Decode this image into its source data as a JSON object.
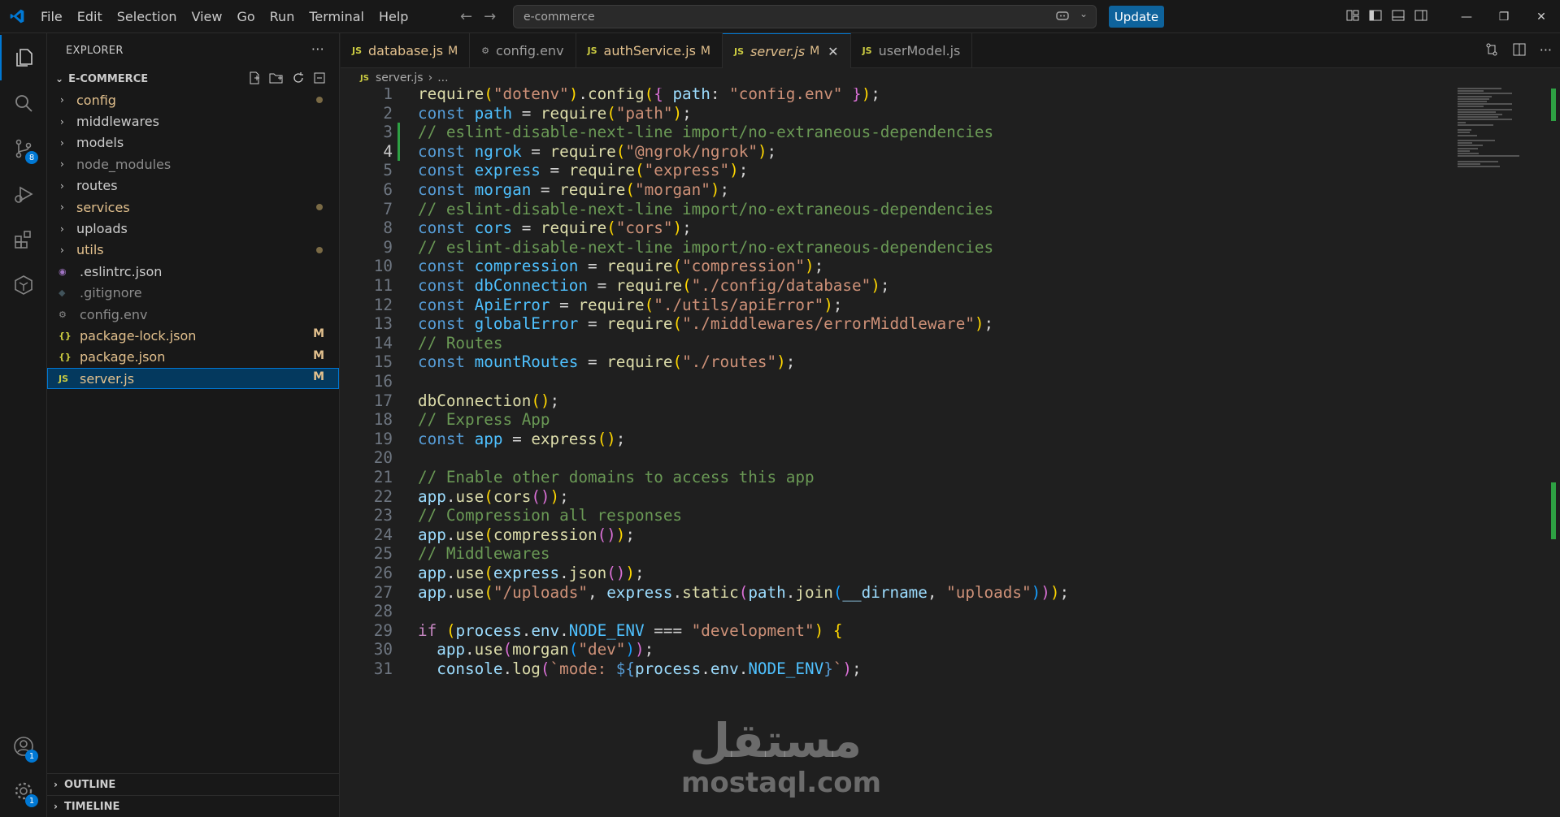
{
  "titlebar": {
    "menu": [
      "File",
      "Edit",
      "Selection",
      "View",
      "Go",
      "Run",
      "Terminal",
      "Help"
    ],
    "search_text": "e-commerce",
    "update_label": "Update"
  },
  "activity": {
    "scm_badge": "8",
    "accounts_badge": "1",
    "settings_badge": "1"
  },
  "sidebar": {
    "title": "EXPLORER",
    "more": "···",
    "project": "E-COMMERCE",
    "folders": [
      {
        "name": "config",
        "color": "#e2c08d",
        "dot": true
      },
      {
        "name": "middlewares",
        "color": "#cccccc",
        "dot": false
      },
      {
        "name": "models",
        "color": "#cccccc",
        "dot": false
      },
      {
        "name": "node_modules",
        "color": "#8c8c8c",
        "dot": false
      },
      {
        "name": "routes",
        "color": "#cccccc",
        "dot": false
      },
      {
        "name": "services",
        "color": "#e2c08d",
        "dot": true
      },
      {
        "name": "uploads",
        "color": "#cccccc",
        "dot": false
      },
      {
        "name": "utils",
        "color": "#e2c08d",
        "dot": true
      }
    ],
    "files": [
      {
        "name": ".eslintrc.json",
        "color": "#cccccc",
        "icon": "◉",
        "icon_color": "#a074c4",
        "mark": ""
      },
      {
        "name": ".gitignore",
        "color": "#8c8c8c",
        "icon": "◆",
        "icon_color": "#41535b",
        "mark": ""
      },
      {
        "name": "config.env",
        "color": "#8c8c8c",
        "icon": "⚙",
        "icon_color": "#8c8c8c",
        "mark": ""
      },
      {
        "name": "package-lock.json",
        "color": "#e2c08d",
        "icon": "{}",
        "icon_color": "#cbcb41",
        "mark": "M"
      },
      {
        "name": "package.json",
        "color": "#e2c08d",
        "icon": "{}",
        "icon_color": "#cbcb41",
        "mark": "M"
      },
      {
        "name": "server.js",
        "color": "#e2c08d",
        "icon": "JS",
        "icon_color": "#cbcb41",
        "mark": "M"
      }
    ],
    "outline": "OUTLINE",
    "timeline": "TIMELINE"
  },
  "tabs": [
    {
      "name": "database.js",
      "icon": "JS",
      "icon_color": "#cbcb41",
      "color": "#e2c08d",
      "mark": "M",
      "active": false
    },
    {
      "name": "config.env",
      "icon": "⚙",
      "icon_color": "#9d9d9d",
      "color": "#9d9d9d",
      "mark": "",
      "active": false
    },
    {
      "name": "authService.js",
      "icon": "JS",
      "icon_color": "#cbcb41",
      "color": "#e2c08d",
      "mark": "M",
      "active": false
    },
    {
      "name": "server.js",
      "icon": "JS",
      "icon_color": "#cbcb41",
      "color": "#e2c08d",
      "mark": "M",
      "active": true
    },
    {
      "name": "userModel.js",
      "icon": "JS",
      "icon_color": "#cbcb41",
      "color": "#9d9d9d",
      "mark": "",
      "active": false
    }
  ],
  "breadcrumb": {
    "icon": "JS",
    "file": "server.js",
    "sep": "›",
    "rest": "..."
  },
  "code_lines": [
    [
      [
        "fn",
        "require"
      ],
      [
        "b1",
        "("
      ],
      [
        "str",
        "\"dotenv\""
      ],
      [
        "b1",
        ")"
      ],
      [
        "pl",
        "."
      ],
      [
        "fn",
        "config"
      ],
      [
        "b1",
        "("
      ],
      [
        "b2",
        "{"
      ],
      [
        "pl",
        " "
      ],
      [
        "var",
        "path"
      ],
      [
        "pl",
        ": "
      ],
      [
        "str",
        "\"config.env\""
      ],
      [
        "pl",
        " "
      ],
      [
        "b2",
        "}"
      ],
      [
        "b1",
        ")"
      ],
      [
        "pl",
        ";"
      ]
    ],
    [
      [
        "kw",
        "const"
      ],
      [
        "pl",
        " "
      ],
      [
        "cnst",
        "path"
      ],
      [
        "pl",
        " = "
      ],
      [
        "fn",
        "require"
      ],
      [
        "b1",
        "("
      ],
      [
        "str",
        "\"path\""
      ],
      [
        "b1",
        ")"
      ],
      [
        "pl",
        ";"
      ]
    ],
    [
      [
        "cm",
        "// eslint-disable-next-line import/no-extraneous-dependencies"
      ]
    ],
    [
      [
        "kw",
        "const"
      ],
      [
        "pl",
        " "
      ],
      [
        "cnst",
        "ngrok"
      ],
      [
        "pl",
        " = "
      ],
      [
        "fn",
        "require"
      ],
      [
        "b1",
        "("
      ],
      [
        "str",
        "\"@ngrok/ngrok\""
      ],
      [
        "b1",
        ")"
      ],
      [
        "pl",
        ";"
      ]
    ],
    [
      [
        "kw",
        "const"
      ],
      [
        "pl",
        " "
      ],
      [
        "cnst",
        "express"
      ],
      [
        "pl",
        " = "
      ],
      [
        "fn",
        "require"
      ],
      [
        "b1",
        "("
      ],
      [
        "str",
        "\"express\""
      ],
      [
        "b1",
        ")"
      ],
      [
        "pl",
        ";"
      ]
    ],
    [
      [
        "kw",
        "const"
      ],
      [
        "pl",
        " "
      ],
      [
        "cnst",
        "morgan"
      ],
      [
        "pl",
        " = "
      ],
      [
        "fn",
        "require"
      ],
      [
        "b1",
        "("
      ],
      [
        "str",
        "\"morgan\""
      ],
      [
        "b1",
        ")"
      ],
      [
        "pl",
        ";"
      ]
    ],
    [
      [
        "cm",
        "// eslint-disable-next-line import/no-extraneous-dependencies"
      ]
    ],
    [
      [
        "kw",
        "const"
      ],
      [
        "pl",
        " "
      ],
      [
        "cnst",
        "cors"
      ],
      [
        "pl",
        " = "
      ],
      [
        "fn",
        "require"
      ],
      [
        "b1",
        "("
      ],
      [
        "str",
        "\"cors\""
      ],
      [
        "b1",
        ")"
      ],
      [
        "pl",
        ";"
      ]
    ],
    [
      [
        "cm",
        "// eslint-disable-next-line import/no-extraneous-dependencies"
      ]
    ],
    [
      [
        "kw",
        "const"
      ],
      [
        "pl",
        " "
      ],
      [
        "cnst",
        "compression"
      ],
      [
        "pl",
        " = "
      ],
      [
        "fn",
        "require"
      ],
      [
        "b1",
        "("
      ],
      [
        "str",
        "\"compression\""
      ],
      [
        "b1",
        ")"
      ],
      [
        "pl",
        ";"
      ]
    ],
    [
      [
        "kw",
        "const"
      ],
      [
        "pl",
        " "
      ],
      [
        "cnst",
        "dbConnection"
      ],
      [
        "pl",
        " = "
      ],
      [
        "fn",
        "require"
      ],
      [
        "b1",
        "("
      ],
      [
        "str",
        "\"./config/database\""
      ],
      [
        "b1",
        ")"
      ],
      [
        "pl",
        ";"
      ]
    ],
    [
      [
        "kw",
        "const"
      ],
      [
        "pl",
        " "
      ],
      [
        "cnst",
        "ApiError"
      ],
      [
        "pl",
        " = "
      ],
      [
        "fn",
        "require"
      ],
      [
        "b1",
        "("
      ],
      [
        "str",
        "\"./utils/apiError\""
      ],
      [
        "b1",
        ")"
      ],
      [
        "pl",
        ";"
      ]
    ],
    [
      [
        "kw",
        "const"
      ],
      [
        "pl",
        " "
      ],
      [
        "cnst",
        "globalError"
      ],
      [
        "pl",
        " = "
      ],
      [
        "fn",
        "require"
      ],
      [
        "b1",
        "("
      ],
      [
        "str",
        "\"./middlewares/errorMiddleware\""
      ],
      [
        "b1",
        ")"
      ],
      [
        "pl",
        ";"
      ]
    ],
    [
      [
        "cm",
        "// Routes"
      ]
    ],
    [
      [
        "kw",
        "const"
      ],
      [
        "pl",
        " "
      ],
      [
        "cnst",
        "mountRoutes"
      ],
      [
        "pl",
        " = "
      ],
      [
        "fn",
        "require"
      ],
      [
        "b1",
        "("
      ],
      [
        "str",
        "\"./routes\""
      ],
      [
        "b1",
        ")"
      ],
      [
        "pl",
        ";"
      ]
    ],
    [],
    [
      [
        "fn",
        "dbConnection"
      ],
      [
        "b1",
        "()"
      ],
      [
        "pl",
        ";"
      ]
    ],
    [
      [
        "cm",
        "// Express App"
      ]
    ],
    [
      [
        "kw",
        "const"
      ],
      [
        "pl",
        " "
      ],
      [
        "cnst",
        "app"
      ],
      [
        "pl",
        " = "
      ],
      [
        "fn",
        "express"
      ],
      [
        "b1",
        "()"
      ],
      [
        "pl",
        ";"
      ]
    ],
    [],
    [
      [
        "cm",
        "// Enable other domains to access this app"
      ]
    ],
    [
      [
        "var",
        "app"
      ],
      [
        "pl",
        "."
      ],
      [
        "fn",
        "use"
      ],
      [
        "b1",
        "("
      ],
      [
        "fn",
        "cors"
      ],
      [
        "b2",
        "()"
      ],
      [
        "b1",
        ")"
      ],
      [
        "pl",
        ";"
      ]
    ],
    [
      [
        "cm",
        "// Compression all responses"
      ]
    ],
    [
      [
        "var",
        "app"
      ],
      [
        "pl",
        "."
      ],
      [
        "fn",
        "use"
      ],
      [
        "b1",
        "("
      ],
      [
        "fn",
        "compression"
      ],
      [
        "b2",
        "()"
      ],
      [
        "b1",
        ")"
      ],
      [
        "pl",
        ";"
      ]
    ],
    [
      [
        "cm",
        "// Middlewares"
      ]
    ],
    [
      [
        "var",
        "app"
      ],
      [
        "pl",
        "."
      ],
      [
        "fn",
        "use"
      ],
      [
        "b1",
        "("
      ],
      [
        "var",
        "express"
      ],
      [
        "pl",
        "."
      ],
      [
        "fn",
        "json"
      ],
      [
        "b2",
        "()"
      ],
      [
        "b1",
        ")"
      ],
      [
        "pl",
        ";"
      ]
    ],
    [
      [
        "var",
        "app"
      ],
      [
        "pl",
        "."
      ],
      [
        "fn",
        "use"
      ],
      [
        "b1",
        "("
      ],
      [
        "str",
        "\"/uploads\""
      ],
      [
        "pl",
        ", "
      ],
      [
        "var",
        "express"
      ],
      [
        "pl",
        "."
      ],
      [
        "fn",
        "static"
      ],
      [
        "b2",
        "("
      ],
      [
        "var",
        "path"
      ],
      [
        "pl",
        "."
      ],
      [
        "fn",
        "join"
      ],
      [
        "b3",
        "("
      ],
      [
        "var",
        "__dirname"
      ],
      [
        "pl",
        ", "
      ],
      [
        "str",
        "\"uploads\""
      ],
      [
        "b3",
        ")"
      ],
      [
        "b2",
        ")"
      ],
      [
        "b1",
        ")"
      ],
      [
        "pl",
        ";"
      ]
    ],
    [],
    [
      [
        "ctl",
        "if"
      ],
      [
        "pl",
        " "
      ],
      [
        "b1",
        "("
      ],
      [
        "var",
        "process"
      ],
      [
        "pl",
        "."
      ],
      [
        "var",
        "env"
      ],
      [
        "pl",
        "."
      ],
      [
        "cnst",
        "NODE_ENV"
      ],
      [
        "pl",
        " === "
      ],
      [
        "str",
        "\"development\""
      ],
      [
        "b1",
        ")"
      ],
      [
        "pl",
        " "
      ],
      [
        "b1",
        "{"
      ]
    ],
    [
      [
        "pl",
        "  "
      ],
      [
        "var",
        "app"
      ],
      [
        "pl",
        "."
      ],
      [
        "fn",
        "use"
      ],
      [
        "b2",
        "("
      ],
      [
        "fn",
        "morgan"
      ],
      [
        "b3",
        "("
      ],
      [
        "str",
        "\"dev\""
      ],
      [
        "b3",
        ")"
      ],
      [
        "b2",
        ")"
      ],
      [
        "pl",
        ";"
      ]
    ],
    [
      [
        "pl",
        "  "
      ],
      [
        "var",
        "console"
      ],
      [
        "pl",
        "."
      ],
      [
        "fn",
        "log"
      ],
      [
        "b2",
        "("
      ],
      [
        "str",
        "`mode: "
      ],
      [
        "kw",
        "${"
      ],
      [
        "var",
        "process"
      ],
      [
        "pl",
        "."
      ],
      [
        "var",
        "env"
      ],
      [
        "pl",
        "."
      ],
      [
        "cnst",
        "NODE_ENV"
      ],
      [
        "kw",
        "}"
      ],
      [
        "str",
        "`"
      ],
      [
        "b2",
        ")"
      ],
      [
        "pl",
        ";"
      ]
    ]
  ],
  "modified_lines": [
    3,
    4
  ],
  "watermark": {
    "arabic": "مستقل",
    "latin": "mostaql.com"
  }
}
